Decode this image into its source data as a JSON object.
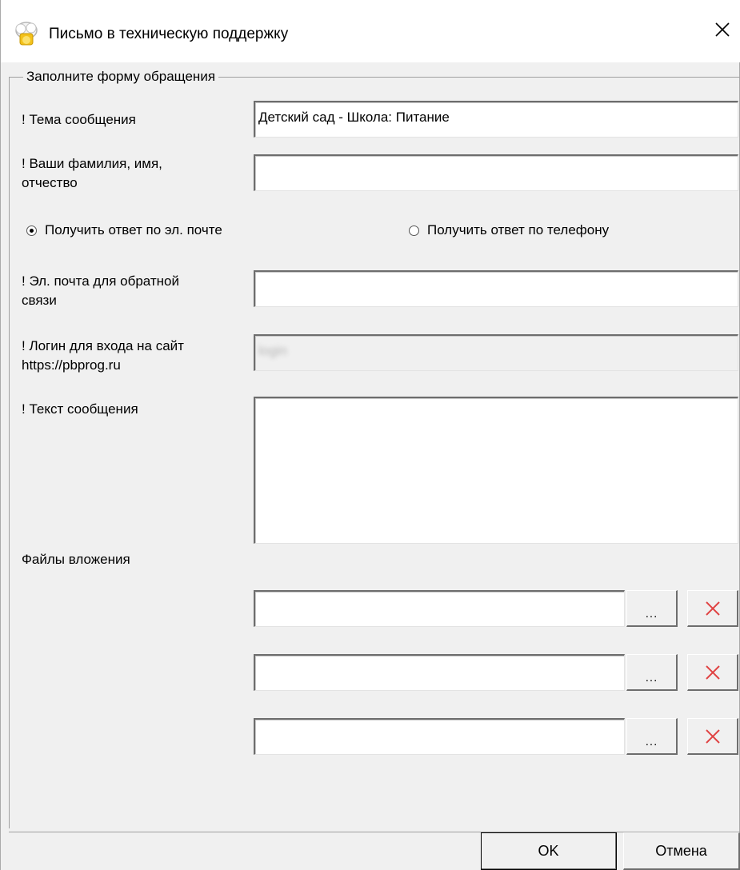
{
  "window": {
    "title": "Письмо в техническую поддержку"
  },
  "group": {
    "title": "Заполните форму обращения"
  },
  "form": {
    "subject_label": "! Тема сообщения",
    "subject_value": "Детский сад - Школа: Питание",
    "name_label_1": "! Ваши фамилия, имя,",
    "name_label_2": "отчество",
    "name_value": "",
    "radio_email_label": "Получить ответ по эл. почте",
    "radio_phone_label": "Получить ответ по телефону",
    "radio_selected": "email",
    "email_label_1": "! Эл. почта для обратной",
    "email_label_2": "связи",
    "email_value": "",
    "login_label_1": "! Логин для входа на сайт",
    "login_label_2": "https://pbprog.ru",
    "login_value": "login",
    "message_label": "! Текст сообщения",
    "message_value": "",
    "attachments_label": "Файлы вложения",
    "browse_label": "...",
    "attachments": [
      "",
      "",
      ""
    ]
  },
  "footer": {
    "ok_label": "OK",
    "cancel_label": "Отмена"
  },
  "colors": {
    "delete_icon": "#e04343"
  }
}
